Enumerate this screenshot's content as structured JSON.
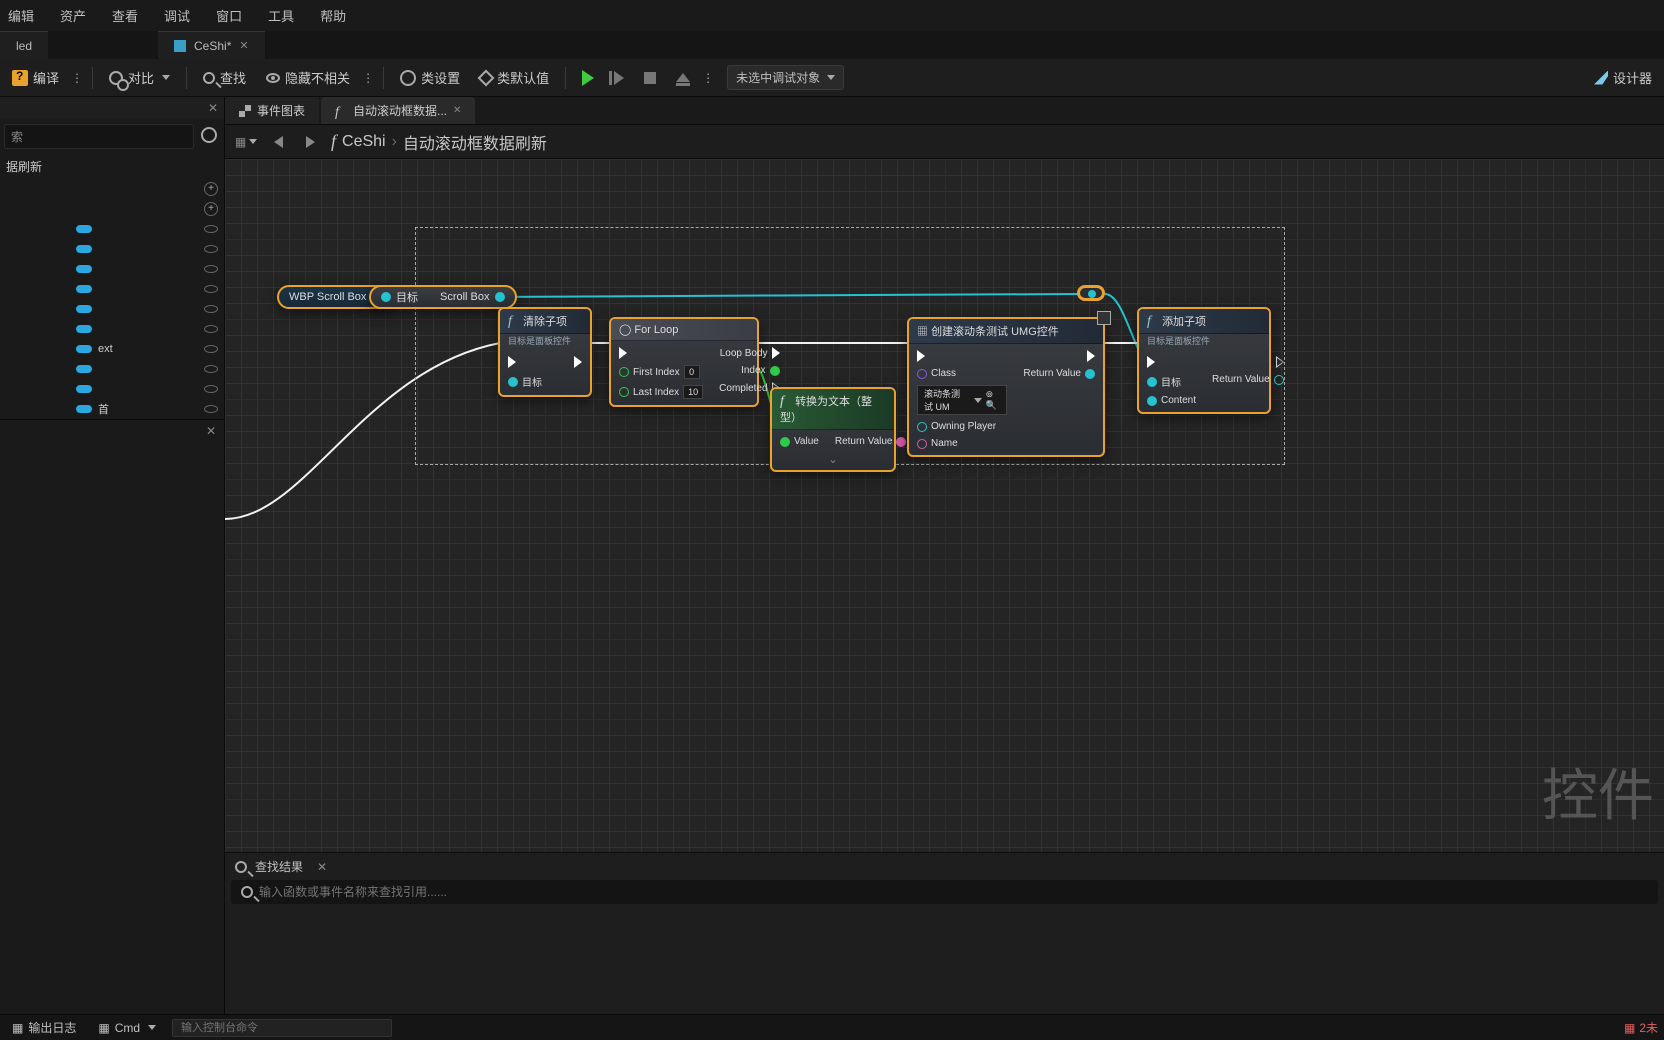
{
  "menu": {
    "items": [
      "编辑",
      "资产",
      "查看",
      "调试",
      "窗口",
      "工具",
      "帮助"
    ]
  },
  "filetabs": {
    "t1": "led",
    "t2": "CeShi*"
  },
  "toolbar": {
    "compile": "编译",
    "diff": "对比",
    "find": "查找",
    "hide": "隐藏不相关",
    "classsettings": "类设置",
    "classdefaults": "类默认值",
    "debug_target": "未选中调试对象",
    "designer": "设计器"
  },
  "graph": {
    "tab_event": "事件图表",
    "tab_fn": "自动滚动框数据...",
    "crumb_obj": "CeShi",
    "crumb_fn": "自动滚动框数据刷新"
  },
  "leftpanel": {
    "search_placeholder": "索",
    "cat1": "据刷新",
    "vars": [
      "",
      "",
      "",
      "",
      "",
      "",
      "ext",
      "",
      "",
      "首"
    ]
  },
  "nodes": {
    "wbp": {
      "label": "WBP Scroll Box"
    },
    "target": {
      "label": "目标",
      "out": "Scroll Box"
    },
    "clear": {
      "title": "清除子项",
      "sub": "目标是面板控件",
      "p_target": "目标"
    },
    "forloop": {
      "title": "For Loop",
      "first": "First Index",
      "first_v": "0",
      "last": "Last Index",
      "last_v": "10",
      "body": "Loop Body",
      "index": "Index",
      "comp": "Completed"
    },
    "totext": {
      "title": "转换为文本（整型）",
      "in": "Value",
      "out": "Return Value"
    },
    "create": {
      "title": "创建滚动条测试 UMG控件",
      "class": "Class",
      "class_v": "滚动条测试 UM",
      "owning": "Owning Player",
      "name": "Name",
      "rv": "Return Value"
    },
    "add": {
      "title": "添加子项",
      "sub": "目标是面板控件",
      "p_target": "目标",
      "p_content": "Content",
      "rv": "Return Value"
    }
  },
  "watermark": "控件",
  "find": {
    "title": "查找结果",
    "placeholder": "输入函数或事件名称来查找引用......"
  },
  "status": {
    "log": "输出日志",
    "cmd": "Cmd",
    "cmd_ph": "输入控制台命令",
    "unsaved": "2未"
  }
}
